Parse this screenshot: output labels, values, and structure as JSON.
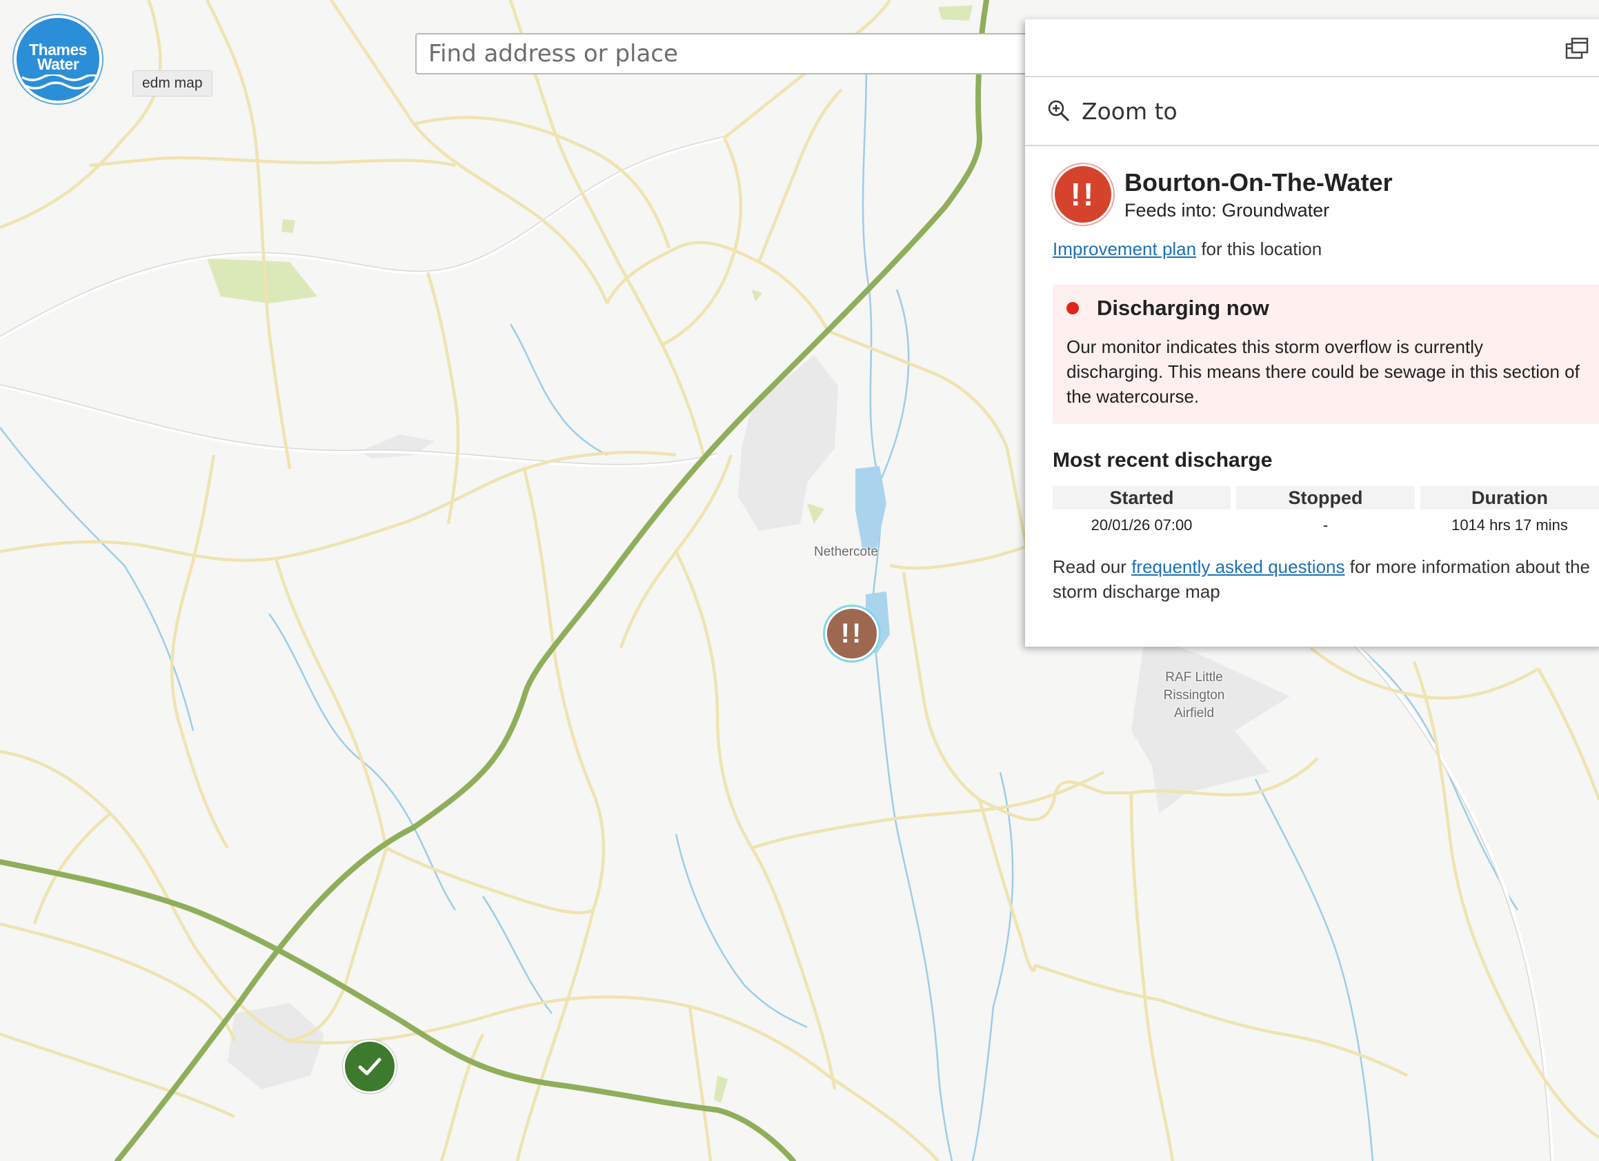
{
  "logo": {
    "line1": "Thames",
    "line2": "Water",
    "tooltip": "edm map"
  },
  "search": {
    "placeholder": "Find address or place"
  },
  "map_labels": {
    "nethercote": "Nethercote",
    "raf_line1": "RAF Little",
    "raf_line2": "Rissington",
    "raf_line3": "Airfield"
  },
  "markers": {
    "alert_symbol": "!!",
    "ok_symbol": "check-icon"
  },
  "popup": {
    "zoom_label": "Zoom to",
    "alert_symbol": "!!",
    "site_name": "Bourton-On-The-Water",
    "feeds_into": "Feeds into: Groundwater",
    "improvement_link": "Improvement plan",
    "improvement_suffix": " for this location",
    "status_title": "Discharging now",
    "status_line1": "Our monitor indicates this storm overflow is currently",
    "status_line2": "discharging. This means there could be sewage in this section of",
    "status_line3": "the watercourse.",
    "recent_title": "Most recent discharge",
    "table_headers": {
      "started": "Started",
      "stopped": "Stopped",
      "duration": "Duration"
    },
    "table_values": {
      "started": "20/01/26 07:00",
      "stopped": "-",
      "duration": "1014 hrs 17 mins"
    },
    "faq_prefix": "Read our ",
    "faq_link": "frequently asked questions",
    "faq_suffix": " for more information about the",
    "faq_line2": "storm discharge map"
  },
  "colors": {
    "road": "#efe3b0",
    "trunk_road": "#8fae5a",
    "water": "#9ccde8",
    "park": "#dbe8b8",
    "brand_blue": "#2a8ed8",
    "alert_red": "#d6432c",
    "ok_green": "#3e7a2d",
    "link_blue": "#1d70b8",
    "status_bg": "#fdf0ee"
  }
}
